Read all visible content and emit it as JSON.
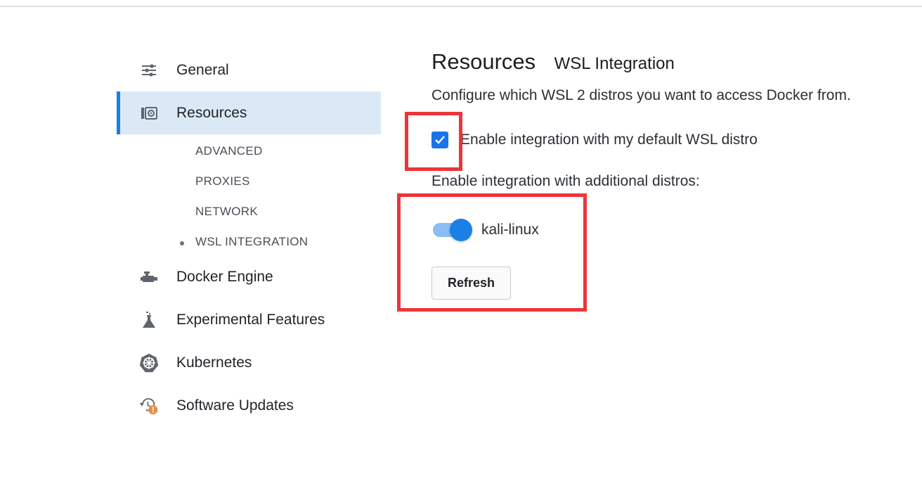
{
  "sidebar": {
    "items": [
      {
        "label": "General",
        "icon": "sliders-icon"
      },
      {
        "label": "Resources",
        "icon": "hard-drive-icon"
      },
      {
        "label": "Docker Engine",
        "icon": "engine-icon"
      },
      {
        "label": "Experimental Features",
        "icon": "flask-icon"
      },
      {
        "label": "Kubernetes",
        "icon": "kubernetes-helm-icon"
      },
      {
        "label": "Software Updates",
        "icon": "history-alert-icon"
      }
    ],
    "resources_sub": [
      "ADVANCED",
      "PROXIES",
      "NETWORK",
      "WSL INTEGRATION"
    ],
    "active_item": "Resources",
    "active_sub": "WSL INTEGRATION"
  },
  "main": {
    "title": "Resources",
    "subtitle": "WSL Integration",
    "description": "Configure which WSL 2 distros you want to access Docker from.",
    "default_distro": {
      "label": "Enable integration with my default WSL distro",
      "checked": true
    },
    "additional_label": "Enable integration with additional distros:",
    "distros": [
      {
        "name": "kali-linux",
        "enabled": true
      }
    ],
    "refresh_label": "Refresh"
  },
  "colors": {
    "accent": "#1a7fe6",
    "active_bg": "#dbe9f6",
    "highlight": "#ec3538",
    "update_badge": "#e8904a"
  }
}
